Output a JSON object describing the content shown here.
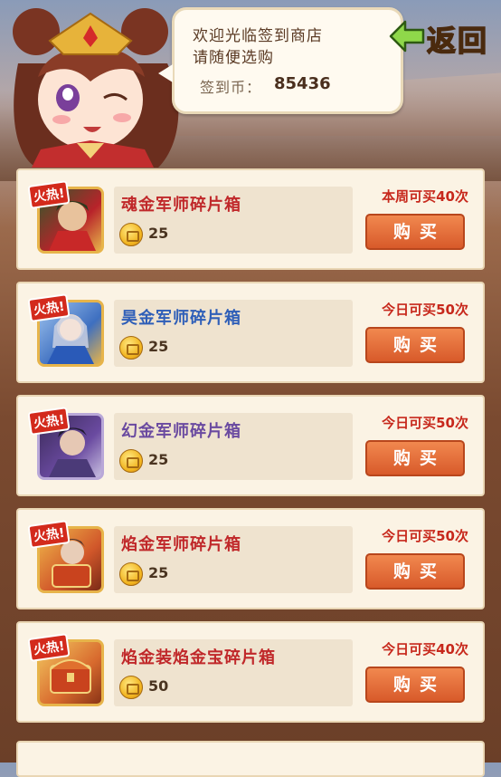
{
  "bubble": {
    "line1": "欢迎光临签到商店",
    "line2": "请随便选购",
    "coin_label": "签到币：",
    "coin_count": "85436"
  },
  "back_button": {
    "label": "返回"
  },
  "colors": {
    "hot_tag": "#d32a1c",
    "limit_text": "#c7281c",
    "buy_button": "#e06a35",
    "name_red": "#c0282a",
    "name_blue": "#2f5fb8",
    "name_purple": "#6a4aa0"
  },
  "items": [
    {
      "hot": "火热!",
      "name": "魂金军师碎片箱",
      "name_color": "#c0282a",
      "price": "25",
      "limit": "本周可买40次",
      "buy": "购买",
      "icon": "hero-portrait-green-red"
    },
    {
      "hot": "火热!",
      "name": "昊金军师碎片箱",
      "name_color": "#2f5fb8",
      "price": "25",
      "limit": "今日可买50次",
      "buy": "购买",
      "icon": "hero-portrait-blue-silver"
    },
    {
      "hot": "火热!",
      "name": "幻金军师碎片箱",
      "name_color": "#6a4aa0",
      "price": "25",
      "limit": "今日可买50次",
      "buy": "购买",
      "icon": "hero-portrait-purple"
    },
    {
      "hot": "火热!",
      "name": "焰金军师碎片箱",
      "name_color": "#c0282a",
      "price": "25",
      "limit": "今日可买50次",
      "buy": "购买",
      "icon": "hero-portrait-orange"
    },
    {
      "hot": "火热!",
      "name": "焰金装焰金宝碎片箱",
      "name_color": "#c0282a",
      "price": "50",
      "limit": "今日可买40次",
      "buy": "购买",
      "icon": "treasure-chest-orange"
    }
  ]
}
